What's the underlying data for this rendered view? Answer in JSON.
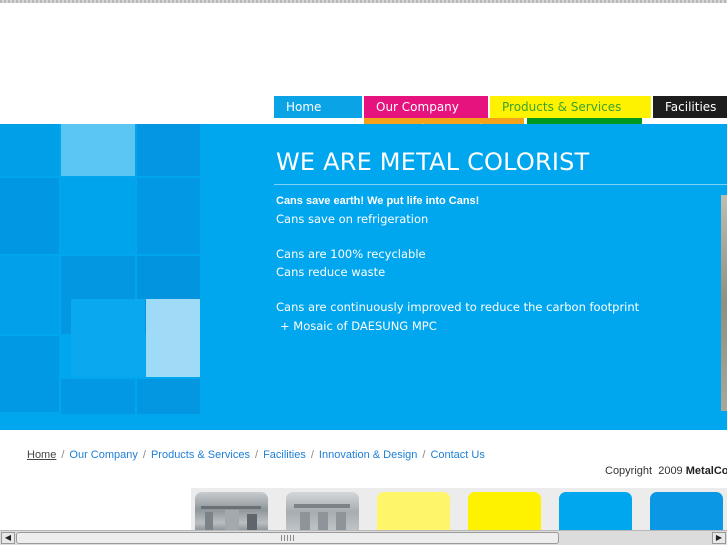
{
  "nav": {
    "home": "Home",
    "our_company": "Our Company",
    "products_services": "Products & Services",
    "facilities": "Facilities",
    "innovation_design": "Innovation & Design",
    "contact_us": "Contact Us"
  },
  "banner": {
    "headline": "WE ARE METAL COLORIST",
    "tagline": "Cans save earth! We put life into Cans!",
    "lines": [
      "Cans save on refrigeration",
      "Cans are 100% recyclable",
      "Cans reduce waste",
      "Cans are continuously improved to reduce the carbon footprint"
    ],
    "mosaic_link": "+ Mosaic of DAESUNG MPC"
  },
  "breadcrumb": {
    "items": [
      "Home",
      "Our Company",
      "Products & Services",
      "Facilities",
      "Innovation & Design",
      "Contact Us"
    ],
    "separator": "/"
  },
  "footer": {
    "copyright_prefix": "Copyright",
    "year": "2009",
    "company": "MetalCo"
  },
  "thumbnails": [
    {
      "icon": "factory-machinery-photo",
      "color": "#9ea4a8"
    },
    {
      "icon": "factory-machinery-photo",
      "color": "#b3b8bc"
    },
    {
      "icon": "yellow-tile",
      "color": "#fff56a"
    },
    {
      "icon": "yellow-tile",
      "color": "#fff200"
    },
    {
      "icon": "blue-tile",
      "color": "#00a6ee"
    },
    {
      "icon": "blue-tile",
      "color": "#0a98e4"
    }
  ],
  "colors": {
    "banner_blue": "#00a6ee",
    "nav_home": "#0aa3e6",
    "nav_company": "#e6127d",
    "nav_products": "#fff200",
    "nav_facilities": "#1d1d1d",
    "nav_innovation": "#f7a21b",
    "nav_contact": "#009a21",
    "link": "#1e7fd6"
  },
  "scrollbar": {
    "left_arrow": "◀",
    "right_arrow": "▶"
  }
}
